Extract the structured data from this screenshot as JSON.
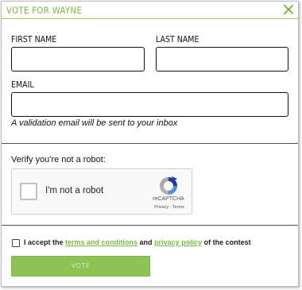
{
  "modal": {
    "title": "VOTE FOR WAYNE"
  },
  "form": {
    "first_name_label": "FIRST NAME",
    "first_name_value": "",
    "last_name_label": "LAST NAME",
    "last_name_value": "",
    "email_label": "EMAIL",
    "email_value": "",
    "email_note": "A validation email will be sent to your inbox"
  },
  "captcha": {
    "prompt": "Verify you're not a robot:",
    "checkbox_label": "I'm not a robot",
    "brand": "reCAPTCHA",
    "links": "Privacy - Terms"
  },
  "terms": {
    "prefix": "I accept the ",
    "terms_link": "terms and conditions",
    "middle": " and ",
    "privacy_link": "privacy policy",
    "suffix": " of the contest"
  },
  "actions": {
    "vote_label": "VOTE"
  },
  "colors": {
    "accent": "#7bb843",
    "button": "#8dc255"
  }
}
